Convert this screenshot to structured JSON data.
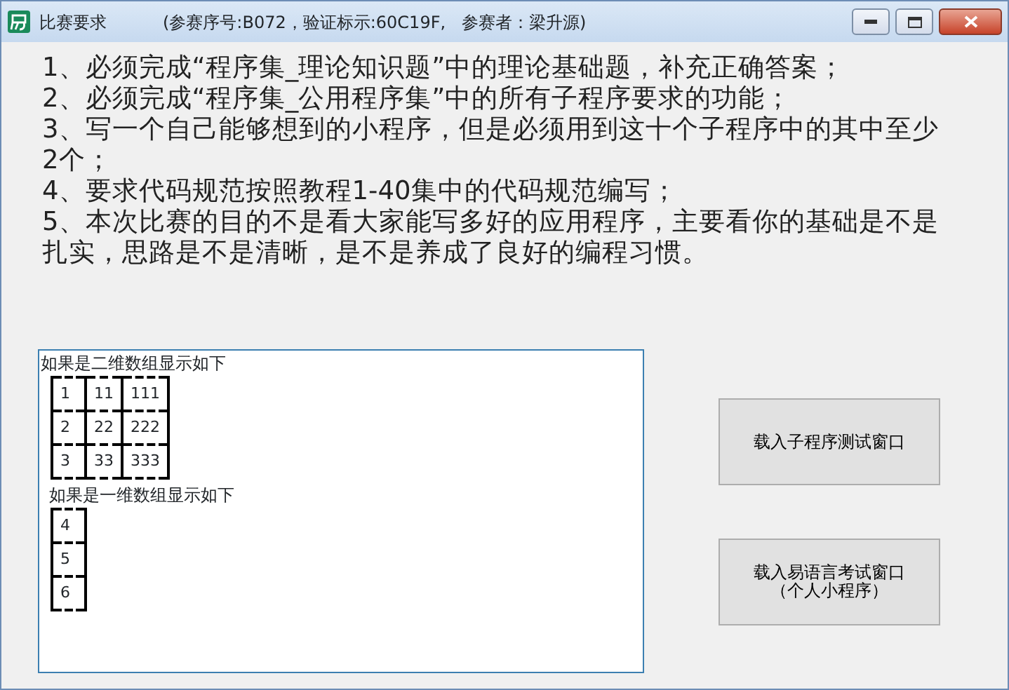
{
  "window": {
    "title": "比赛要求",
    "subtitle": "(参赛序号:B072，验证标示:60C19F,   参赛者：梁升源)"
  },
  "requirements": [
    "1、必须完成“程序集_理论知识题”中的理论基础题，补充正确答案；",
    "2、必须完成“程序集_公用程序集”中的所有子程序要求的功能；",
    "3、写一个自己能够想到的小程序，但是必须用到这十个子程序中的其中至少2个；",
    "4、要求代码规范按照教程1-40集中的代码规范编写；",
    "5、本次比赛的目的不是看大家能写多好的应用程序，主要看你的基础是不是扎实，思路是不是清晰，是不是养成了良好的编程习惯。"
  ],
  "output": {
    "caption_2d": "如果是二维数组显示如下",
    "grid_2d": [
      [
        "1",
        "11",
        "111"
      ],
      [
        "2",
        "22",
        "222"
      ],
      [
        "3",
        "33",
        "333"
      ]
    ],
    "caption_1d": "如果是一维数组显示如下",
    "grid_1d": [
      "4",
      "5",
      "6"
    ]
  },
  "buttons": [
    {
      "lines": [
        "载入子程序测试窗口"
      ]
    },
    {
      "lines": [
        "载入易语言考试窗口",
        "（个人小程序）"
      ]
    }
  ]
}
